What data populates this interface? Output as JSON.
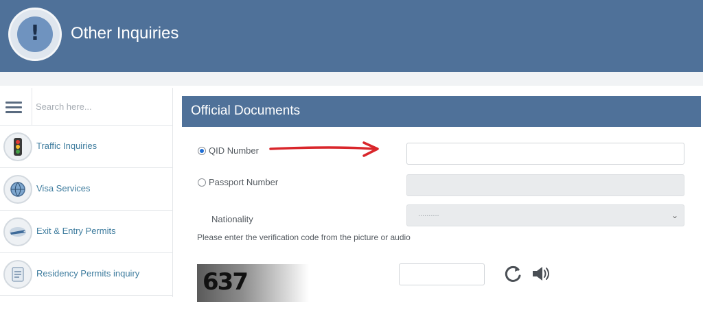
{
  "header": {
    "title": "Other Inquiries",
    "logo_icon": "exclamation-icon"
  },
  "sidebar": {
    "search_placeholder": "Search here...",
    "items": [
      {
        "label": "Traffic Inquiries",
        "icon": "traffic-light-icon"
      },
      {
        "label": "Visa Services",
        "icon": "globe-icon"
      },
      {
        "label": "Exit & Entry Permits",
        "icon": "airplane-icon"
      },
      {
        "label": "Residency Permits inquiry",
        "icon": "document-icon"
      }
    ]
  },
  "panel": {
    "title": "Official Documents",
    "qid_label": "QID Number",
    "passport_label": "Passport Number",
    "nationality_label": "Nationality",
    "nationality_value": "..........",
    "verification_text": "Please enter the verification code from the picture or audio",
    "captcha_code": "637",
    "selected_option": "QID Number"
  },
  "colors": {
    "header": "#4f7199",
    "annotation_arrow": "#d9262b",
    "link": "#3e7c9e"
  }
}
